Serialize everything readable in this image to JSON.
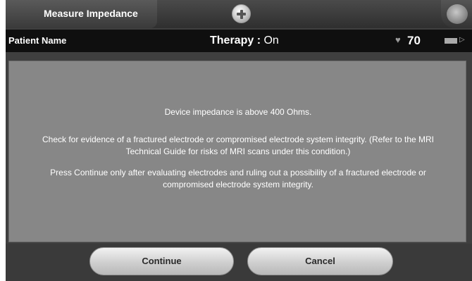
{
  "header": {
    "title": "Measure Impedance"
  },
  "status": {
    "patient_label": "Patient Name",
    "therapy_label": "Therapy : ",
    "therapy_value": "On",
    "heart_rate": "70"
  },
  "dialog": {
    "line1": "Device impedance is above 400 Ohms.",
    "line2": "Check for evidence of a fractured electrode or compromised electrode system integrity. (Refer to the MRI Technical Guide for risks of MRI scans under this condition.)",
    "line3": "Press Continue only after evaluating electrodes and ruling out a possibility of a fractured electrode or compromised electrode system integrity."
  },
  "buttons": {
    "continue_label": "Continue",
    "cancel_label": "Cancel"
  },
  "icons": {
    "add": "plus-circle-icon",
    "menu": "globe-icon",
    "heart": "heart-icon",
    "battery": "battery-icon",
    "signal": "signal-icon"
  }
}
